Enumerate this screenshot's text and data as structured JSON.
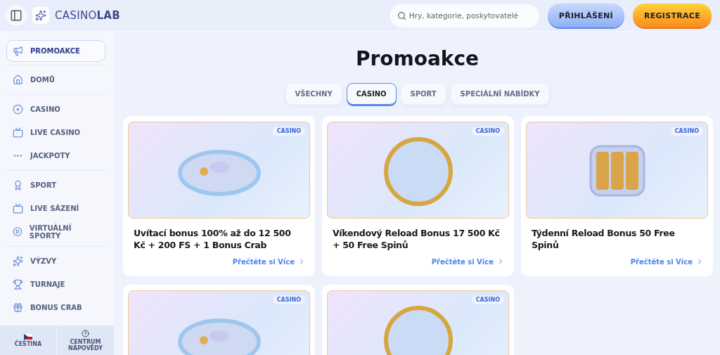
{
  "logo": "CASINO**LAB**",
  "search": {
    "placeholder": "Hry, kategorie, poskytovatelé"
  },
  "buttons": [
    {
      "label": "PŘIHLÁŠENÍ",
      "kind": "login"
    },
    {
      "label": "REGISTRACE",
      "kind": "register"
    }
  ],
  "sidebar": {
    "groups": [
      [
        {
          "label": "PROMOAKCE",
          "selected": true
        }
      ],
      [
        {
          "label": "DOMŮ",
          "selected": false
        }
      ],
      [
        {
          "label": "CASINO",
          "selected": false
        },
        {
          "label": "LIVE CASINO",
          "selected": false
        },
        {
          "label": "JACKPOTY",
          "selected": false
        }
      ],
      [
        {
          "label": "SPORT",
          "selected": false
        },
        {
          "label": "LIVE SÁZENÍ",
          "selected": false
        },
        {
          "label": "VIRTUÁLNÍ SPORTY",
          "selected": false
        }
      ],
      [
        {
          "label": "VÝZVY",
          "selected": false
        },
        {
          "label": "TURNAJE",
          "selected": false
        },
        {
          "label": "BONUS CRAB",
          "selected": false
        }
      ]
    ],
    "footer": [
      {
        "label": "ČEŠTINA",
        "kind": "language"
      },
      {
        "label": "CENTRUM NÁPOVĚDY",
        "kind": "help"
      }
    ]
  },
  "page_title": "Promoakce",
  "filters": [
    {
      "label": "VŠECHNY",
      "selected": false
    },
    {
      "label": "CASINO",
      "selected": true
    },
    {
      "label": "SPORT",
      "selected": false
    },
    {
      "label": "SPECIÁLNÍ NABÍDKY",
      "selected": false
    }
  ],
  "promos": [
    {
      "tag": "CASINO",
      "title": "Uvítací bonus 100% až do 12 500 Kč + 200 FS + 1 Bonus Crab",
      "link": "Přečtěte si Více"
    },
    {
      "tag": "CASINO",
      "title": "Víkendový Reload Bonus 17 500 Kč + 50 Free Spinů",
      "link": "Přečtěte si Více"
    },
    {
      "tag": "CASINO",
      "title": "Týdenní Reload Bonus 50 Free Spinů",
      "link": "Přečtěte si Více"
    },
    {
      "tag": "CASINO"
    },
    {
      "tag": "CASINO"
    }
  ]
}
